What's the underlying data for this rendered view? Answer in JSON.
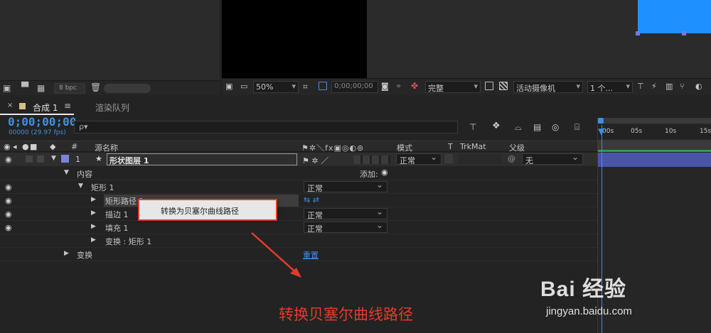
{
  "project_toolbar": {
    "bpc": "8 bpc"
  },
  "viewer_toolbar": {
    "zoom": "50%",
    "timecode": "0;00;00;00",
    "quality": "完整",
    "camera": "活动摄像机",
    "views": "1 个..."
  },
  "tabs": {
    "comp_tab": "合成 1",
    "render_tab": "渲染队列"
  },
  "timeline": {
    "current_time": "0;00;00;00",
    "fps_info": "00000 (29.97 fps)",
    "search_placeholder": "ρ▾"
  },
  "columns": {
    "num": "#",
    "source_name": "源名称",
    "mode": "模式",
    "t": "T",
    "trkmat": "TrkMat",
    "parent": "父级"
  },
  "layer": {
    "index": "1",
    "name": "形状图层 1",
    "mode": "正常",
    "parent": "无"
  },
  "tree": {
    "contents": "内容",
    "add": "添加:",
    "rect": "矩形 1",
    "rect_mode": "正常",
    "rect_path": "矩形路径 1",
    "stroke": "描边 1",
    "stroke_mode": "正常",
    "fill": "填充 1",
    "fill_mode": "正常",
    "transform_rect": "变换 : 矩形 1",
    "transform": "变换",
    "reset": "重置"
  },
  "ruler": {
    "t0": "00s",
    "t5": "05s",
    "t10": "10s",
    "t15": "15s"
  },
  "context_menu": {
    "item": "转换为贝塞尔曲线路径"
  },
  "annotation": "转换贝塞尔曲线路径",
  "watermark": {
    "brand": "Bai 经验",
    "url": "jingyan.baidu.com"
  },
  "colors": {
    "accent": "#3f8fe6",
    "layer_bar": "#4a55a7",
    "annotation": "#e53a2c"
  }
}
